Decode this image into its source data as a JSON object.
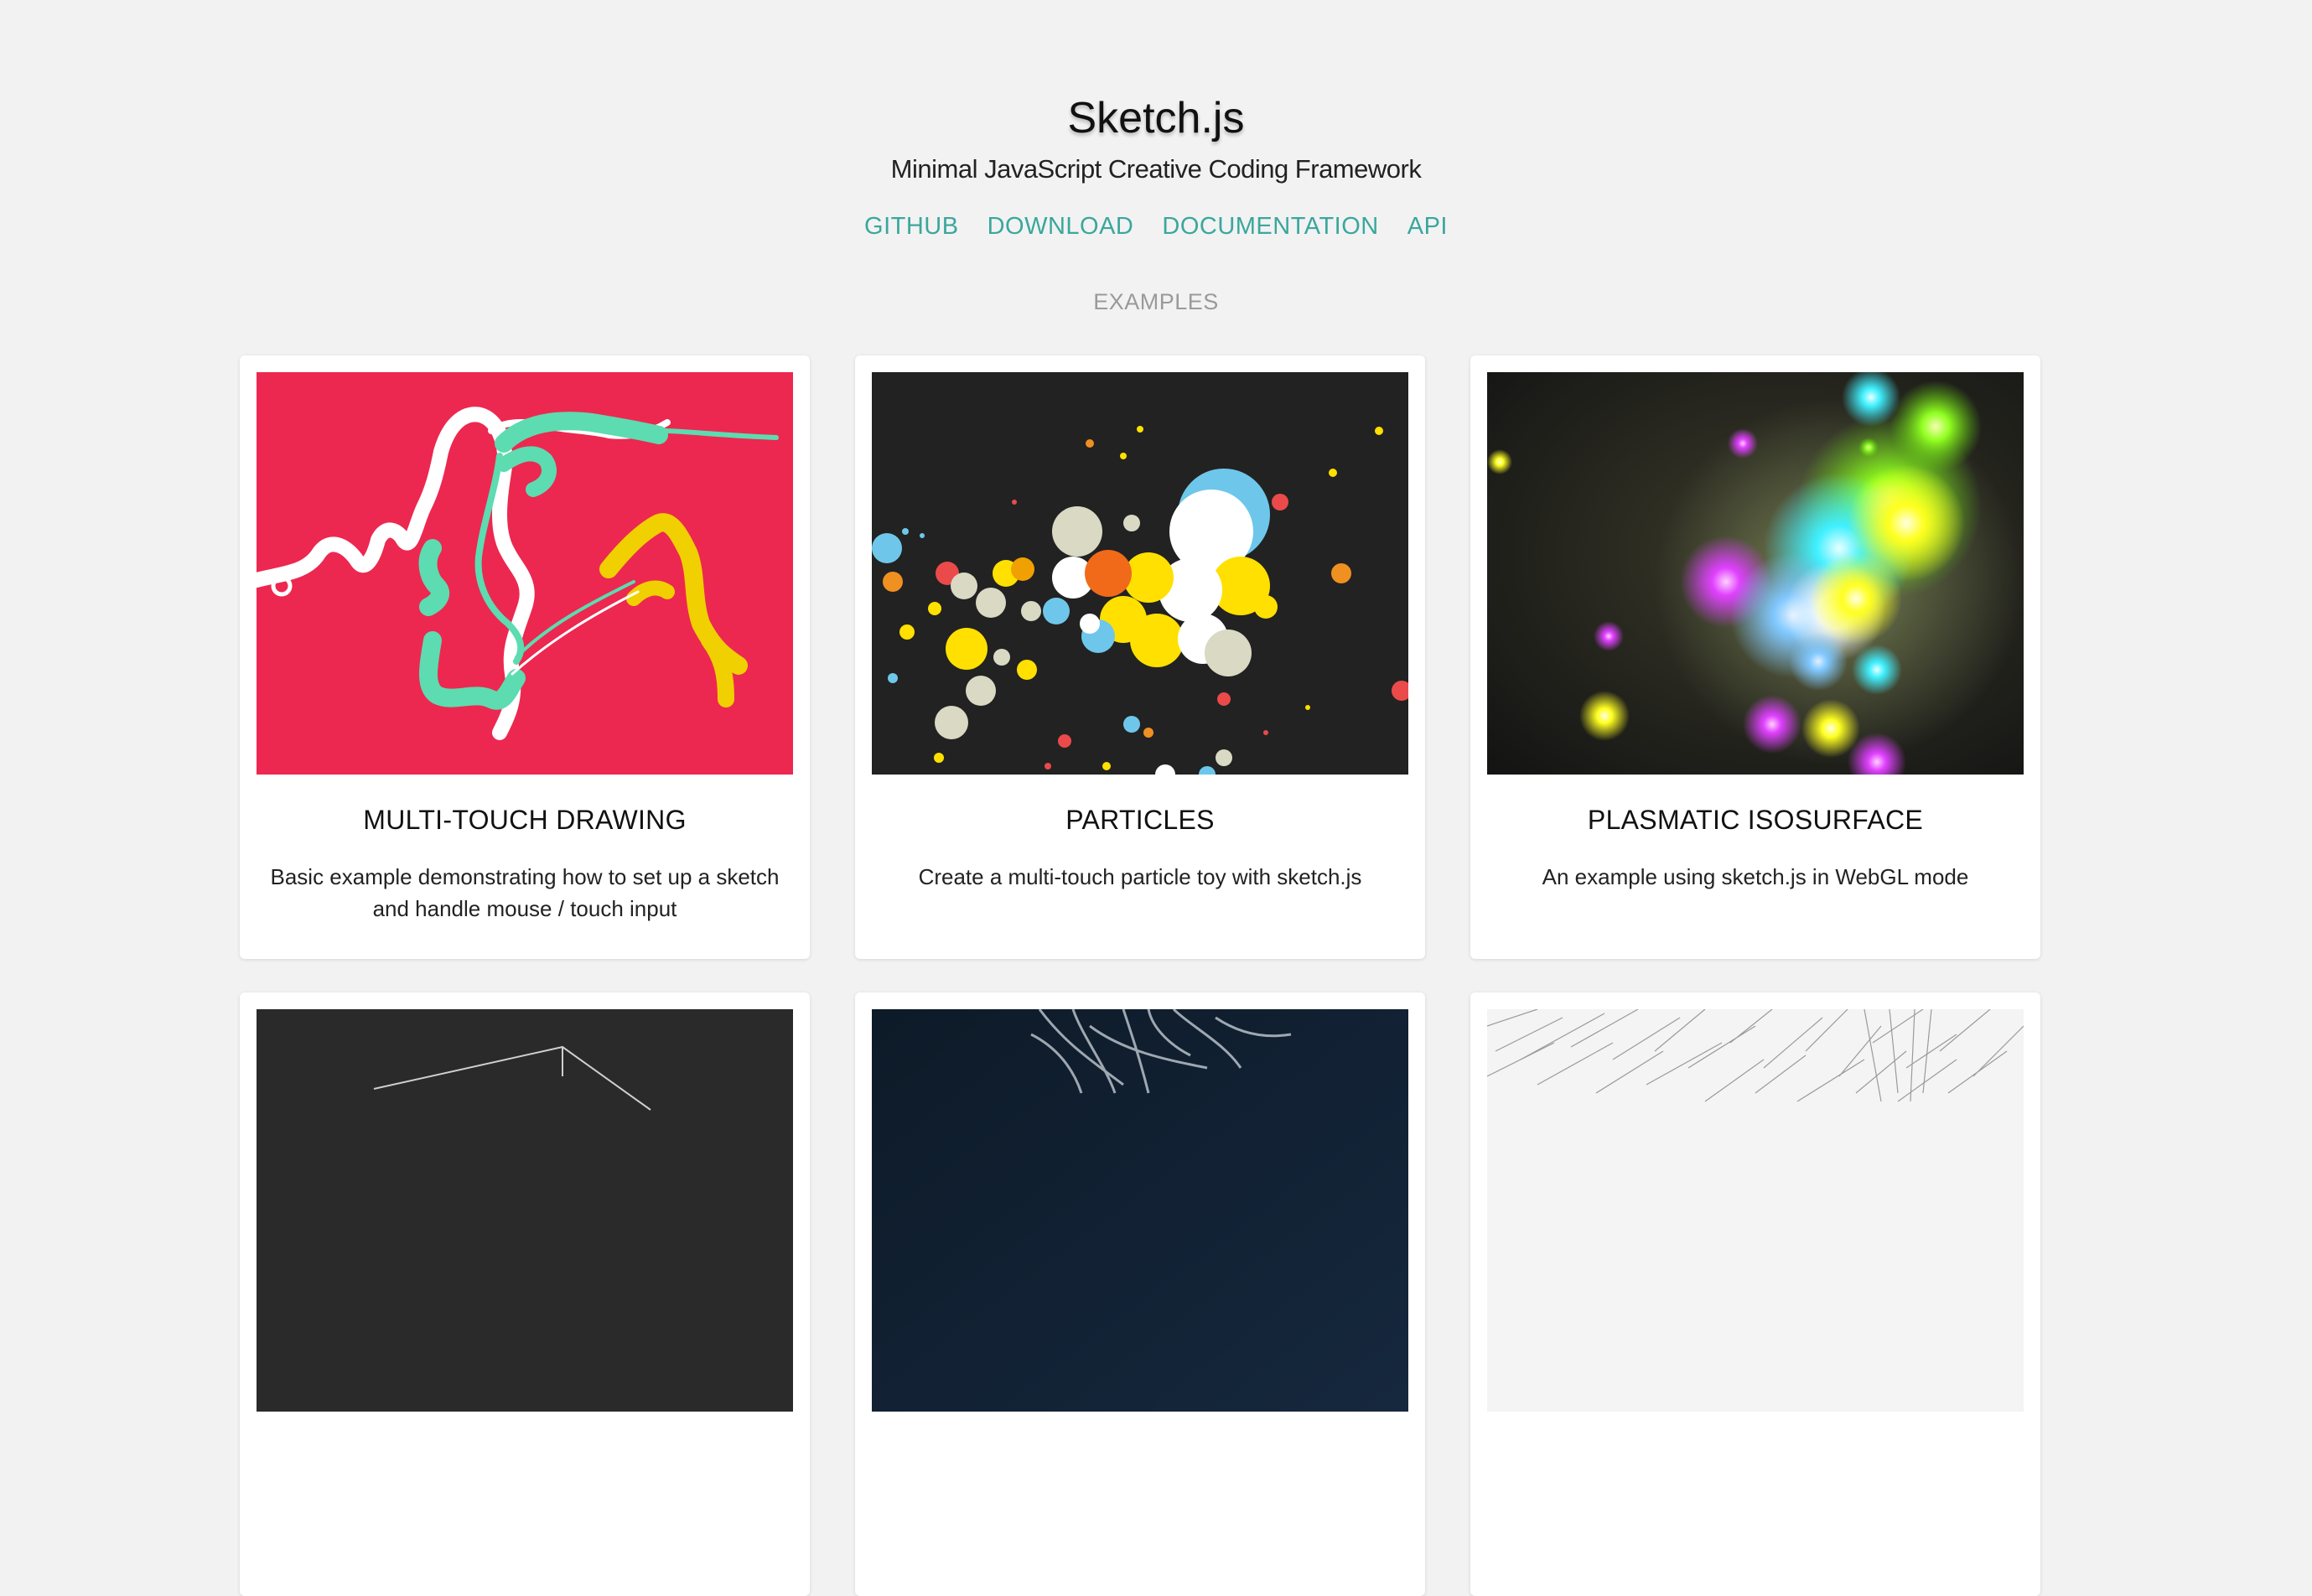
{
  "header": {
    "title": "Sketch.js",
    "subtitle": "Minimal JavaScript Creative Coding Framework"
  },
  "nav": {
    "links": [
      "GITHUB",
      "DOWNLOAD",
      "DOCUMENTATION",
      "API"
    ]
  },
  "examples": {
    "label": "EXAMPLES",
    "cards": [
      {
        "title": "MULTI-TOUCH DRAWING",
        "description": "Basic example demonstrating how to set up a sketch and handle mouse / touch input"
      },
      {
        "title": "PARTICLES",
        "description": "Create a multi-touch particle toy with sketch.js"
      },
      {
        "title": "PLASMATIC ISOSURFACE",
        "description": "An example using sketch.js in WebGL mode"
      }
    ]
  },
  "colors": {
    "accent": "#3aa79d",
    "background": "#f2f2f2",
    "drawing_bg": "#ec2850",
    "particles_bg": "#222222"
  }
}
